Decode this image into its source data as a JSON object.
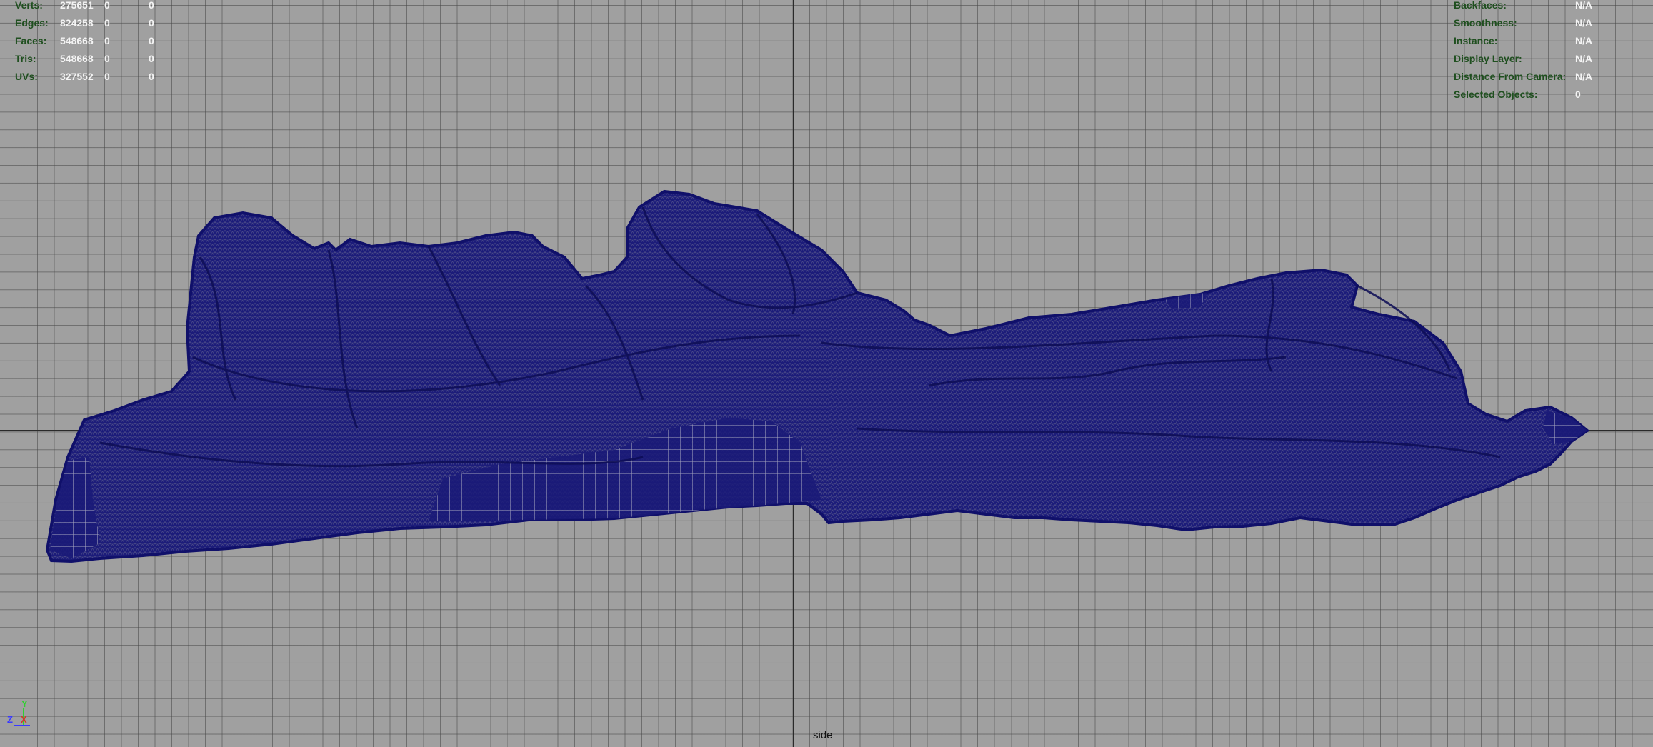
{
  "viewport": {
    "camera_name": "side",
    "colors": {
      "background": "#a0a0a0",
      "grid": "#555555",
      "axis_lines": "#2a2a2a",
      "wireframe": "#1a1a80",
      "hud_label": "#1f4f1f",
      "hud_value": "#f4f4f4"
    }
  },
  "poly_count": {
    "rows": [
      {
        "label": "Verts:",
        "v1": "275651",
        "v2": "0",
        "v3": "0"
      },
      {
        "label": "Edges:",
        "v1": "824258",
        "v2": "0",
        "v3": "0"
      },
      {
        "label": "Faces:",
        "v1": "548668",
        "v2": "0",
        "v3": "0"
      },
      {
        "label": "Tris:",
        "v1": "548668",
        "v2": "0",
        "v3": "0"
      },
      {
        "label": "UVs:",
        "v1": "327552",
        "v2": "0",
        "v3": "0"
      }
    ]
  },
  "object_details": {
    "rows": [
      {
        "label": "Backfaces:",
        "value": "N/A"
      },
      {
        "label": "Smoothness:",
        "value": "N/A"
      },
      {
        "label": "Instance:",
        "value": "N/A"
      },
      {
        "label": "Display Layer:",
        "value": "N/A"
      },
      {
        "label": "Distance From Camera:",
        "value": "N/A"
      },
      {
        "label": "Selected Objects:",
        "value": "0"
      }
    ]
  },
  "axis_gizmo": {
    "y_label": "Y",
    "z_label": "Z",
    "x_label": "X",
    "y_color": "#2fd02f",
    "z_color": "#3a3aff",
    "x_color": "#d03a2a"
  }
}
